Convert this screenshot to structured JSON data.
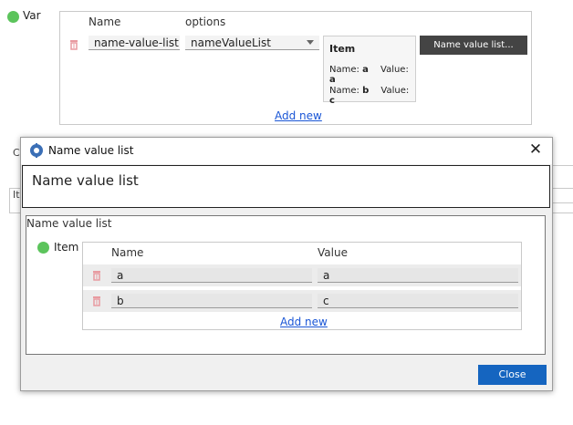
{
  "var_section": {
    "label": "Var",
    "columns": {
      "name": "Name",
      "options": "options"
    },
    "row": {
      "name_value": "name-value-list",
      "options_value": "nameValueList"
    },
    "item_preview": {
      "title": "Item",
      "rows": [
        {
          "name_label": "Name:",
          "name_value": "a",
          "value_label": "Value:",
          "value_value": "a"
        },
        {
          "name_label": "Name:",
          "name_value": "b",
          "value_label": "Value:",
          "value_value": "c"
        }
      ]
    },
    "action_button": "Name value list...",
    "add_new": "Add new"
  },
  "background_fragments": {
    "frag1": "C",
    "frag2": "It"
  },
  "dialog": {
    "title": "Name value list",
    "header_title": "Name value list",
    "section_title": "Name value list",
    "item_label": "Item",
    "columns": {
      "name": "Name",
      "value": "Value"
    },
    "rows": [
      {
        "name": "a",
        "value": "a"
      },
      {
        "name": "b",
        "value": "c"
      }
    ],
    "add_new": "Add new",
    "close_button": "Close"
  },
  "colors": {
    "status_dot": "#5cc45c",
    "trash_icon": "#e89aa0",
    "close_button": "#1565c0",
    "dark_button": "#444444",
    "link": "#1a56d6"
  }
}
